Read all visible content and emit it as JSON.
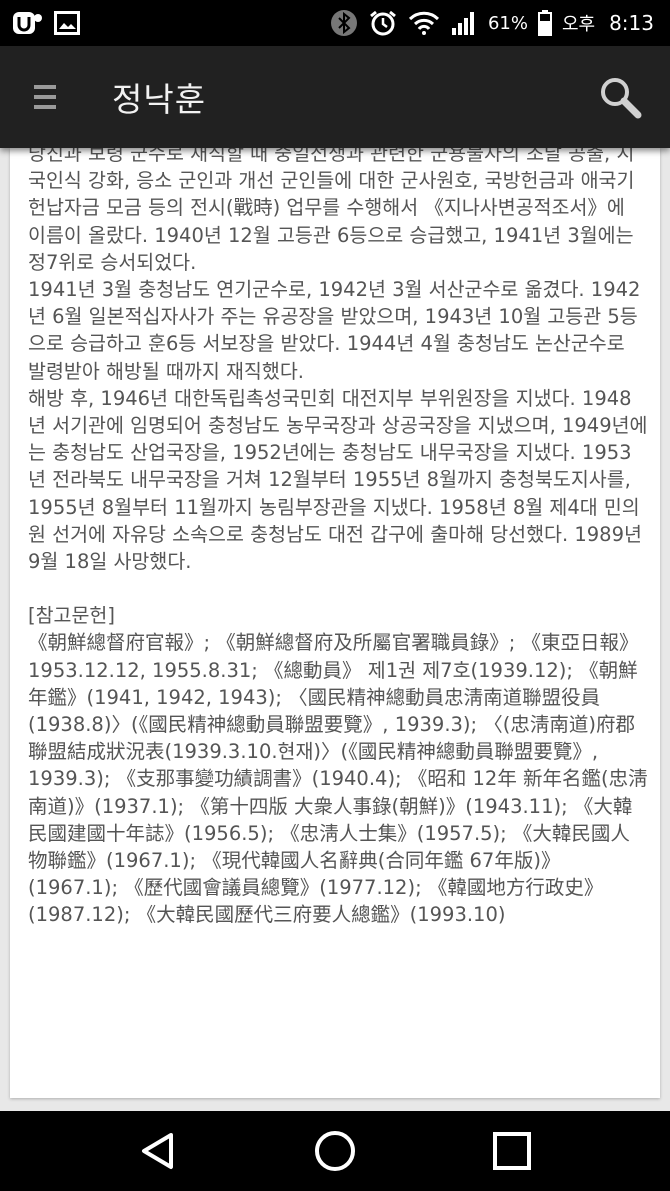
{
  "status_bar": {
    "battery_percent": "61%",
    "ampm": "오후",
    "time": "8:13",
    "icons": [
      "app-u-icon",
      "image-icon",
      "bluetooth-icon",
      "alarm-icon",
      "wifi-icon",
      "signal-icon",
      "battery-icon"
    ]
  },
  "app_bar": {
    "title": "정낙훈",
    "menu_icon": "hamburger-menu-icon",
    "search_icon": "search-icon"
  },
  "article": {
    "paragraphs": [
      "당진과 보령 군수로 재직할 때 중일전쟁과 관련한 군용물자의 조달 공출, 시국인식 강화, 응소 군인과 개선 군인들에 대한 군사원호, 국방헌금과 애국기 헌납자금 모금 등의 전시(戰時) 업무를 수행해서 《지나사변공적조서》에 이름이 올랐다. 1940년 12월 고등관 6등으로 승급했고, 1941년 3월에는 정7위로 승서되었다.",
      "1941년 3월 충청남도 연기군수로, 1942년 3월 서산군수로 옮겼다. 1942년 6월 일본적십자사가 주는 유공장을 받았으며, 1943년 10월 고등관 5등으로 승급하고 훈6등 서보장을 받았다. 1944년 4월 충청남도 논산군수로 발령받아 해방될 때까지 재직했다.",
      "해방 후, 1946년 대한독립촉성국민회 대전지부 부위원장을 지냈다. 1948년 서기관에 임명되어 충청남도 농무국장과 상공국장을 지냈으며, 1949년에는 충청남도 산업국장을, 1952년에는 충청남도 내무국장을 지냈다. 1953년 전라북도 내무국장을 거쳐 12월부터 1955년 8월까지 충청북도지사를, 1955년 8월부터 11월까지 농림부장관을 지냈다. 1958년 8월 제4대 민의원 선거에 자유당 소속으로 충청남도 대전 갑구에 출마해 당선했다. 1989년 9월 18일 사망했다."
    ],
    "references_heading": "[참고문헌]",
    "references": "《朝鮮總督府官報》; 《朝鮮總督府及所屬官署職員錄》; 《東亞日報》 1953.12.12, 1955.8.31; 《總動員》 제1권 제7호(1939.12); 《朝鮮年鑑》(1941, 1942, 1943); 〈國民精神總動員忠淸南道聯盟役員(1938.8)〉(《國民精神總動員聯盟要覽》, 1939.3); 〈(忠淸南道)府郡聯盟結成狀況表(1939.3.10.현재)〉(《國民精神總動員聯盟要覽》, 1939.3); 《支那事變功績調書》(1940.4); 《昭和 12年 新年名鑑(忠淸南道)》(1937.1); 《第十四版 大衆人事錄(朝鮮)》(1943.11); 《大韓民國建國十年誌》(1956.5); 《忠淸人士集》(1957.5); 《大韓民國人物聯鑑》(1967.1); 《現代韓國人名辭典(合同年鑑 67年版)》(1967.1); 《歷代國會議員總覽》(1977.12); 《韓國地方行政史》(1987.12); 《大韓民國歷代三府要人總鑑》(1993.10)"
  },
  "nav_bar": {
    "back_icon": "back-triangle-icon",
    "home_icon": "home-circle-icon",
    "recents_icon": "recents-square-icon"
  }
}
